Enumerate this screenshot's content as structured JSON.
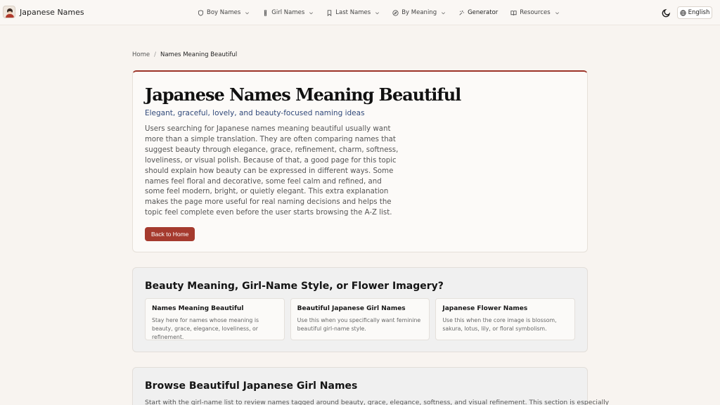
{
  "header": {
    "brand": "Japanese Names",
    "nav": [
      {
        "label": "Boy Names",
        "icon": "shield-icon",
        "dropdown": true
      },
      {
        "label": "Girl Names",
        "icon": "flask-icon",
        "dropdown": true
      },
      {
        "label": "Last Names",
        "icon": "bookmark-icon",
        "dropdown": true
      },
      {
        "label": "By Meaning",
        "icon": "compass-icon",
        "dropdown": true
      },
      {
        "label": "Generator",
        "icon": "sparkle-icon",
        "dropdown": false
      },
      {
        "label": "Resources",
        "icon": "book-icon",
        "dropdown": true
      }
    ],
    "language": "English"
  },
  "breadcrumb": {
    "home": "Home",
    "separator": "/",
    "current": "Names Meaning Beautiful"
  },
  "hero": {
    "title": "Japanese Names Meaning Beautiful",
    "subtitle": "Elegant, graceful, lovely, and beauty-focused naming ideas",
    "description": "Users searching for Japanese names meaning beautiful usually want more than a simple translation. They are often comparing names that suggest beauty through elegance, grace, refinement, charm, softness, loveliness, or visual polish. Because of that, a good page for this topic should explain how beauty can be expressed in different ways. Some names feel floral and decorative, some feel calm and refined, and some feel modern, bright, or quietly elegant. This extra explanation makes the page more useful for real naming decisions and helps the topic feel complete even before the user starts browsing the A-Z list.",
    "back_button": "Back to Home"
  },
  "compare": {
    "title": "Beauty Meaning, Girl-Name Style, or Flower Imagery?",
    "cards": [
      {
        "title": "Names Meaning Beautiful",
        "text": "Stay here for names whose meaning is beauty, grace, elegance, loveliness, or refinement."
      },
      {
        "title": "Beautiful Japanese Girl Names",
        "text": "Use this when you specifically want feminine beautiful girl-name style."
      },
      {
        "title": "Japanese Flower Names",
        "text": "Use this when the core image is blossom, sakura, lotus, lily, or floral symbolism."
      }
    ]
  },
  "browse": {
    "title": "Browse Beautiful Japanese Girl Names",
    "lead": "Start with the girl-name list to review names tagged around beauty, grace, elegance, softness, and visual refinement. This section is especially"
  },
  "colors": {
    "accent": "#a53a2e",
    "subtitle": "#30497a",
    "background": "#f8f4f0"
  }
}
